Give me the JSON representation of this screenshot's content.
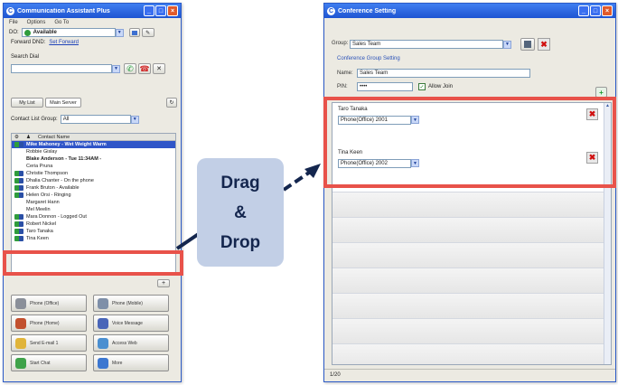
{
  "left_window": {
    "title": "Communication Assistant Plus",
    "menu": [
      "File",
      "Options",
      "Go To"
    ],
    "status_prefix": "DO:",
    "status_value": "Available",
    "forward_label": "Forward DND:",
    "forward_link": "Set Forward",
    "search_label": "Search Dial",
    "tabs": [
      "My List",
      "Main Server"
    ],
    "contact_group_label": "Contact List Group:",
    "contact_group_value": "All",
    "column_header": "Contact Name",
    "contacts": [
      {
        "name": "Mike Mahoney  - Wet Weight Warm",
        "status": "online",
        "style": "sel"
      },
      {
        "name": "Robbie Gislay",
        "status": "blank",
        "style": ""
      },
      {
        "name": "Blake Anderson  - Tue 11:34AM -",
        "status": "blank",
        "style": "bold"
      },
      {
        "name": "Ceria Pruna",
        "status": "blank",
        "style": ""
      },
      {
        "name": "Christie Thompson",
        "status": "online",
        "style": ""
      },
      {
        "name": "Dhalia Chanter  - On the phone",
        "status": "online",
        "style": ""
      },
      {
        "name": "Frank Bruton  - Available",
        "status": "online",
        "style": ""
      },
      {
        "name": "Helen Orsi  - Ringing",
        "status": "online",
        "style": ""
      },
      {
        "name": "Margaret Hann",
        "status": "blank",
        "style": ""
      },
      {
        "name": "Mel Meelin",
        "status": "blank",
        "style": ""
      },
      {
        "name": "Mara Donnon  - Logged Out",
        "status": "online",
        "style": ""
      },
      {
        "name": "Robert Nickel",
        "status": "online",
        "style": ""
      },
      {
        "name": "Taro Tanaka",
        "status": "online",
        "style": ""
      },
      {
        "name": "Tina Keen",
        "status": "online",
        "style": ""
      }
    ],
    "buttons": [
      "Phone (Office)",
      "Phone (Mobile)",
      "Phone (Home)",
      "Voice Message",
      "Send E-mail 1",
      "Access Web",
      "Start Chat",
      "More"
    ]
  },
  "badge": {
    "line1": "Drag",
    "line2": "&",
    "line3": "Drop"
  },
  "right_window": {
    "title": "Conference Setting",
    "group_label": "Group:",
    "group_value": "Sales Team",
    "section_link": "Conference Group Setting",
    "name_label": "Name:",
    "name_value": "Sales Team",
    "pin_label": "PIN:",
    "pin_value": "••••",
    "allow_join": "Allow Join",
    "members": [
      {
        "name": "Taro Tanaka",
        "phone": "Phone(Office)  2001"
      },
      {
        "name": "Tina Keen",
        "phone": "Phone(Office)  2002"
      }
    ],
    "status_text": "1/20"
  },
  "colors": {
    "highlight": "#e8524a",
    "badge_bg": "#c2cfe6",
    "titlebar": "#1e54d2"
  }
}
